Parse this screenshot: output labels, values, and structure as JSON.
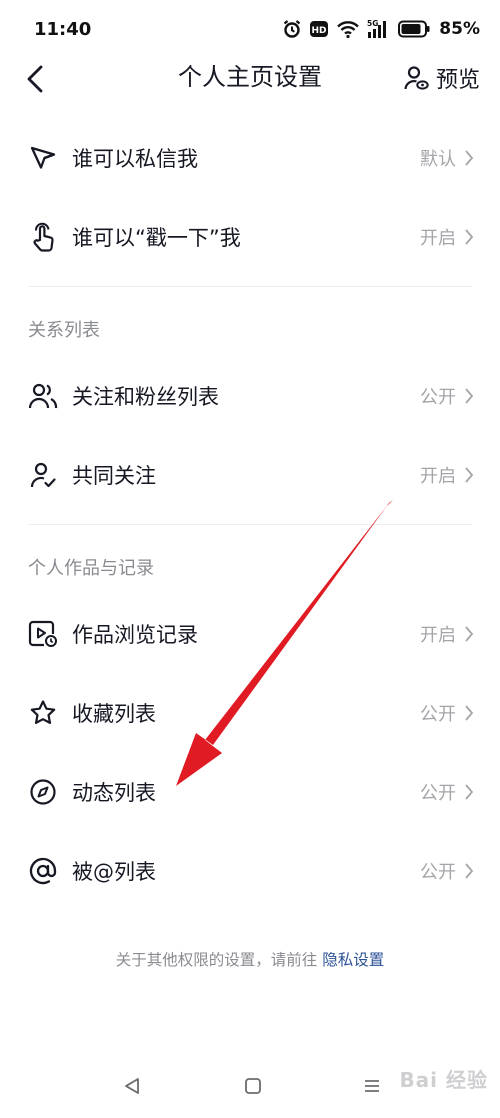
{
  "status_bar": {
    "time": "11:40",
    "network_badge": "HD",
    "signal_badge": "5G",
    "battery": "85%",
    "icons": [
      "alarm-icon",
      "hd-icon",
      "wifi-icon",
      "signal-5g-icon",
      "battery-icon"
    ]
  },
  "nav": {
    "title": "个人主页设置",
    "preview_label": "预览",
    "back_icon": "chevron-left-icon",
    "preview_icon": "user-view-icon"
  },
  "rows": {
    "dm": {
      "label": "谁可以私信我",
      "value": "默认",
      "icon": "send-icon"
    },
    "poke": {
      "label": "谁可以“戳一下”我",
      "value": "开启",
      "icon": "finger-tap-icon"
    },
    "follow_list": {
      "label": "关注和粉丝列表",
      "value": "公开",
      "icon": "users-icon"
    },
    "mutual": {
      "label": "共同关注",
      "value": "开启",
      "icon": "user-check-icon"
    },
    "history": {
      "label": "作品浏览记录",
      "value": "开启",
      "icon": "video-history-icon"
    },
    "favorites": {
      "label": "收藏列表",
      "value": "公开",
      "icon": "star-icon"
    },
    "moments": {
      "label": "动态列表",
      "value": "公开",
      "icon": "compass-icon"
    },
    "mentions": {
      "label": "被@列表",
      "value": "公开",
      "icon": "at-icon"
    }
  },
  "sections": {
    "relations": "关系列表",
    "works": "个人作品与记录"
  },
  "footer": {
    "text": "关于其他权限的设置，请前往 ",
    "link": "隐私设置"
  },
  "annotation": {
    "color": "#e01b24",
    "icon": "red-arrow-annotation"
  },
  "watermark": {
    "text": "Bai 经验"
  },
  "system_nav": {
    "icons": [
      "back-triangle-icon",
      "home-square-icon",
      "menu-lines-icon"
    ]
  }
}
